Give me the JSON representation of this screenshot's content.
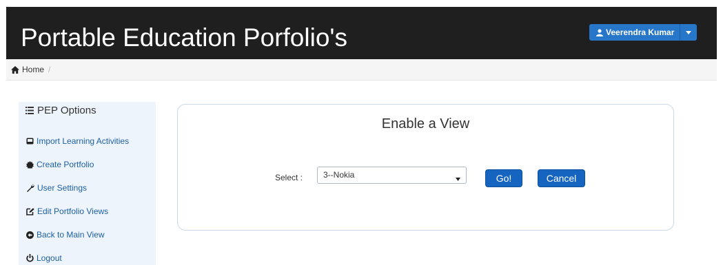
{
  "header": {
    "title": "Portable Education Porfolio's",
    "user": {
      "name": "Veerendra Kumar",
      "icon": "user-icon",
      "caret_icon": "caret-down-icon"
    }
  },
  "breadcrumb": {
    "home_label": "Home",
    "separator": "/",
    "home_icon": "home-icon"
  },
  "sidebar": {
    "title": "PEP Options",
    "title_icon": "list-icon",
    "items": [
      {
        "label": "Import Learning Activities",
        "icon": "inbox-icon"
      },
      {
        "label": "Create Portfolio",
        "icon": "certificate-icon"
      },
      {
        "label": "User Settings",
        "icon": "wrench-icon"
      },
      {
        "label": "Edit Portfolio Views",
        "icon": "edit-icon"
      },
      {
        "label": "Back to Main View",
        "icon": "arrow-circle-left-icon"
      },
      {
        "label": "Logout",
        "icon": "power-icon"
      }
    ]
  },
  "panel": {
    "title": "Enable a View",
    "select_label": "Select :",
    "select_value": "3--Nokia",
    "go_label": "Go!",
    "cancel_label": "Cancel"
  },
  "colors": {
    "header_bg": "#1f1f1f",
    "accent": "#1565c0",
    "sidebar_bg": "#eef4fb",
    "link": "#1d5fa3"
  }
}
